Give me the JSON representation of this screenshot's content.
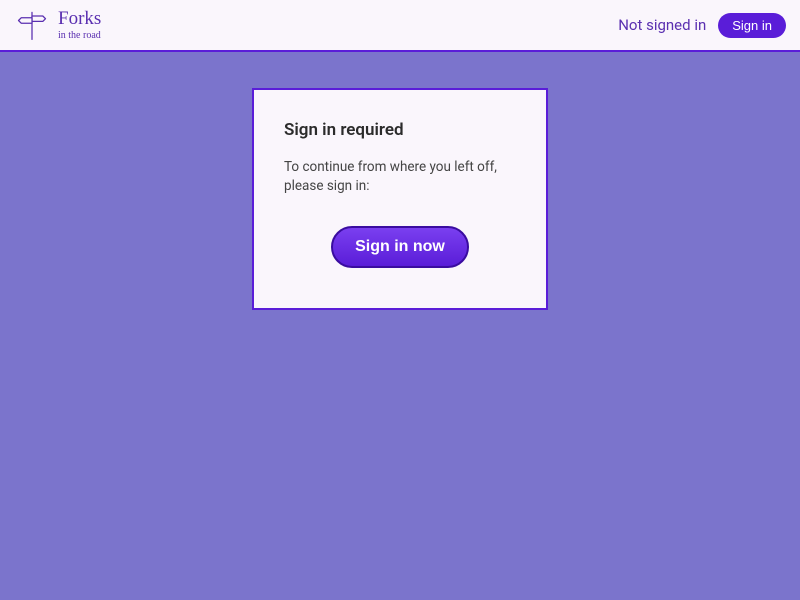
{
  "header": {
    "logo": {
      "title": "Forks",
      "subtitle": "in the road"
    },
    "auth_status": "Not signed in",
    "signin_label": "Sign in"
  },
  "card": {
    "title": "Sign in required",
    "body": "To continue from where you left off, please sign in:",
    "cta_label": "Sign in now"
  },
  "colors": {
    "primary": "#5a1dd8",
    "bg": "#7b74cc",
    "panel": "#faf6fc",
    "text_purple": "#5a2fb0"
  }
}
